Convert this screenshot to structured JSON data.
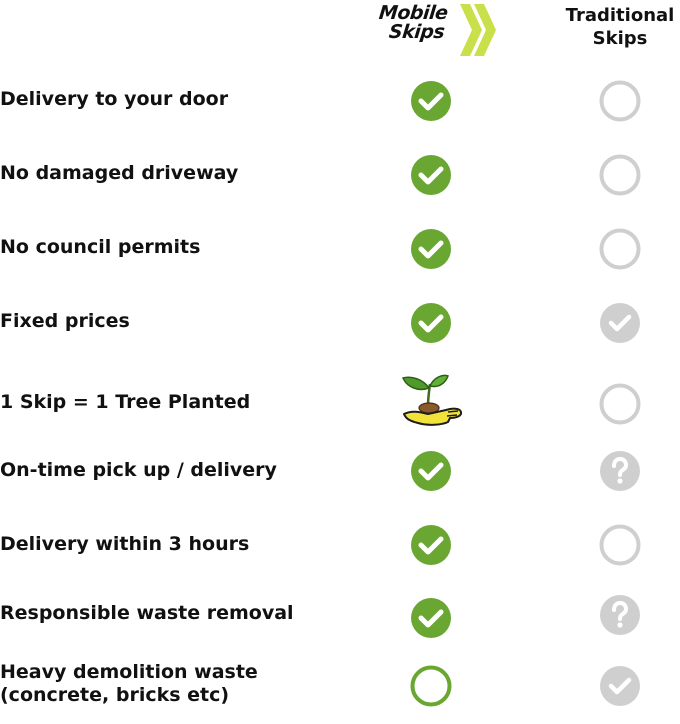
{
  "brand": {
    "logo_line1": "Mobile",
    "logo_line2": "Skips",
    "accent": "#c9e04a",
    "check_green": "#6aa632",
    "grey": "#cfcfcf"
  },
  "columns": {
    "traditional_line1": "Traditional",
    "traditional_line2": "Skips"
  },
  "rows": [
    {
      "label": "Delivery to your door",
      "mobile": "check",
      "traditional": "empty"
    },
    {
      "label": "No damaged driveway",
      "mobile": "check",
      "traditional": "empty"
    },
    {
      "label": "No council permits",
      "mobile": "check",
      "traditional": "empty"
    },
    {
      "label": "Fixed prices",
      "mobile": "check",
      "traditional": "check-grey"
    },
    {
      "label": "1 Skip = 1 Tree Planted",
      "mobile": "plant-in-hand",
      "traditional": "empty"
    },
    {
      "label": "On-time pick up / delivery",
      "mobile": "check",
      "traditional": "question"
    },
    {
      "label": "Delivery within 3 hours",
      "mobile": "check",
      "traditional": "empty"
    },
    {
      "label": "Responsible waste removal",
      "mobile": "check",
      "traditional": "question"
    },
    {
      "label_line1": "Heavy demolition waste",
      "label_line2": "(concrete, bricks etc)",
      "mobile": "empty-green",
      "traditional": "check-grey"
    }
  ]
}
